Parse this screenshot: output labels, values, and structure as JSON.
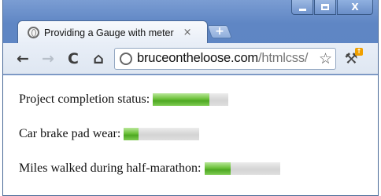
{
  "window": {
    "tab_title": "Providing a Gauge with meter",
    "tab_close_glyph": "×",
    "new_tab_glyph": "+",
    "favicon": "globe-icon"
  },
  "toolbar": {
    "back_glyph": "←",
    "forward_glyph": "→",
    "reload_glyph": "C",
    "home_glyph": "⌂",
    "url_host": "bruceontheloose.com",
    "url_path": "/htmlcss/",
    "star_glyph": "☆",
    "wrench_glyph": "🔧"
  },
  "meters": [
    {
      "label": "Project completion status:",
      "value": 0.75
    },
    {
      "label": "Car brake pad wear:",
      "value": 0.2
    },
    {
      "label": "Miles walked during half-marathon:",
      "value": 0.35
    }
  ],
  "colors": {
    "meter_fill": "#5cb82f",
    "meter_track": "#dcdcdc",
    "chrome_frame": "#6a8ec8"
  }
}
